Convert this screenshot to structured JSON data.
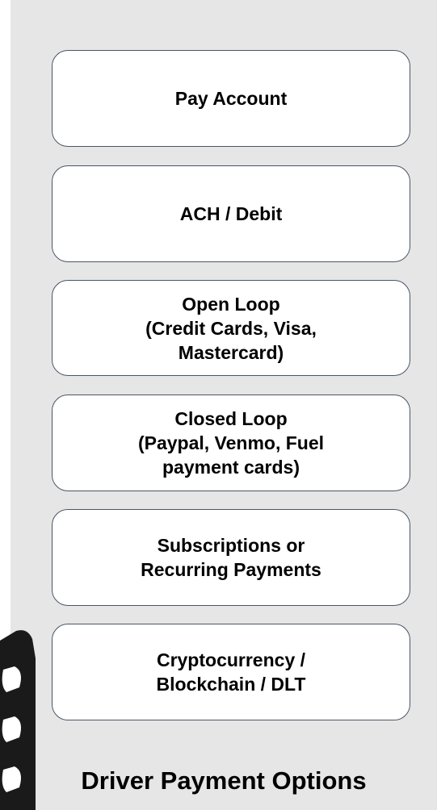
{
  "title": "Driver Payment Options",
  "options": [
    {
      "label": "Pay Account"
    },
    {
      "label": "ACH / Debit"
    },
    {
      "label": "Open Loop\n(Credit Cards, Visa,\nMastercard)"
    },
    {
      "label": "Closed Loop\n(Paypal, Venmo, Fuel\npayment cards)"
    },
    {
      "label": "Subscriptions or\nRecurring Payments"
    },
    {
      "label": "Cryptocurrency /\nBlockchain / DLT"
    }
  ],
  "icons": {
    "device": "car-key-fob-icon"
  },
  "colors": {
    "panel_background": "#e6e6e6",
    "box_border": "#4a5566",
    "box_fill": "#ffffff",
    "text": "#000000"
  }
}
